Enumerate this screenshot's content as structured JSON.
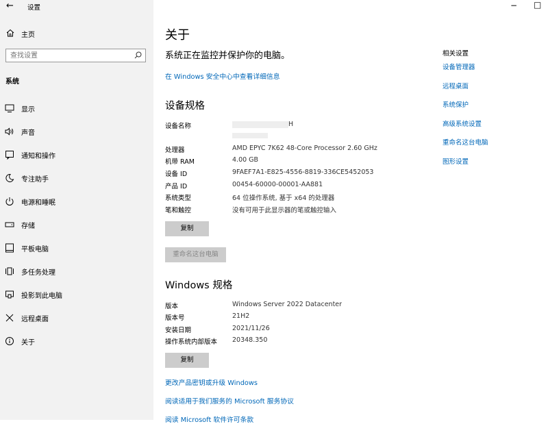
{
  "window": {
    "title": "设置",
    "back_glyph": "←",
    "minimize_glyph": "−",
    "maximize_glyph": "□"
  },
  "sidebar": {
    "home": "主页",
    "search_placeholder": "查找设置",
    "section": "系统",
    "items": [
      {
        "label": "显示",
        "icon": "monitor-icon"
      },
      {
        "label": "声音",
        "icon": "speaker-icon"
      },
      {
        "label": "通知和操作",
        "icon": "notification-icon"
      },
      {
        "label": "专注助手",
        "icon": "moon-icon"
      },
      {
        "label": "电源和睡眠",
        "icon": "power-icon"
      },
      {
        "label": "存储",
        "icon": "storage-icon"
      },
      {
        "label": "平板电脑",
        "icon": "tablet-icon"
      },
      {
        "label": "多任务处理",
        "icon": "multitask-icon"
      },
      {
        "label": "投影到此电脑",
        "icon": "project-icon"
      },
      {
        "label": "远程桌面",
        "icon": "remote-icon"
      },
      {
        "label": "关于",
        "icon": "info-icon"
      }
    ]
  },
  "main": {
    "title": "关于",
    "status": "系统正在监控并保护你的电脑。",
    "security_link": "在 Windows 安全中心中查看详细信息",
    "device_header": "设备规格",
    "device_specs": [
      {
        "key": "设备名称",
        "value": "H"
      },
      {
        "key": "处理器",
        "value": "AMD EPYC 7K62 48-Core Processor   2.60 GHz"
      },
      {
        "key": "机带 RAM",
        "value": "4.00 GB"
      },
      {
        "key": "设备 ID",
        "value": "9FAEF7A1-E825-4556-8819-336CE5452053"
      },
      {
        "key": "产品 ID",
        "value": "00454-60000-00001-AA881"
      },
      {
        "key": "系统类型",
        "value": "64 位操作系统, 基于 x64 的处理器"
      },
      {
        "key": "笔和触控",
        "value": "没有可用于此显示器的笔或触控输入"
      }
    ],
    "copy_button": "复制",
    "rename_button": "重命名这台电脑",
    "windows_header": "Windows 规格",
    "windows_specs": [
      {
        "key": "版本",
        "value": "Windows Server 2022 Datacenter"
      },
      {
        "key": "版本号",
        "value": "21H2"
      },
      {
        "key": "安装日期",
        "value": "2021/11/26"
      },
      {
        "key": "操作系统内部版本",
        "value": "20348.350"
      }
    ],
    "copy_button2": "复制",
    "links": [
      "更改产品密钥或升级 Windows",
      "阅读适用于我们服务的 Microsoft 服务协议",
      "阅读 Microsoft 软件许可条款"
    ]
  },
  "related": {
    "header": "相关设置",
    "links": [
      "设备管理器",
      "远程桌面",
      "系统保护",
      "高级系统设置",
      "重命名这台电脑",
      "图形设置"
    ]
  },
  "colors": {
    "accent": "#0067b8",
    "sidebar_bg": "#f2f2f2",
    "button_bg": "#cccccc"
  }
}
